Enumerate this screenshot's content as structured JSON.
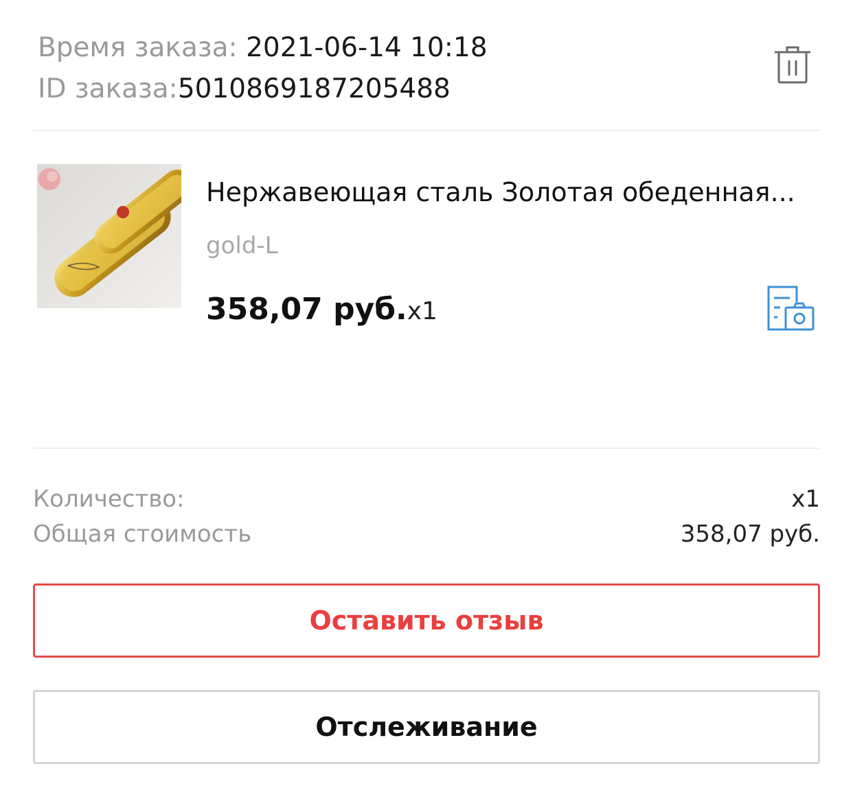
{
  "order": {
    "time_label": "Время заказа: ",
    "time_value": "2021-06-14 10:18",
    "id_label": "ID заказа:",
    "id_value": "5010869187205488"
  },
  "product": {
    "title": "Нержавеющая сталь Золотая обеденная...",
    "sku": "gold-L",
    "price": "358,07 руб.",
    "qty": "x1",
    "image_icon": "golden-tray-image"
  },
  "summary": {
    "quantity_label": "Количество:",
    "quantity_value": "x1",
    "total_label": "Общая стоимость",
    "total_value": "358,07 руб."
  },
  "buttons": {
    "review": "Оставить отзыв",
    "tracking": "Отслеживание"
  },
  "icons": {
    "delete": "trash-icon",
    "photo_doc": "photo-document-icon"
  },
  "colors": {
    "accent_red": "#e9403f",
    "link_blue": "#3d8fd6",
    "muted_text": "#9a9a9a"
  }
}
